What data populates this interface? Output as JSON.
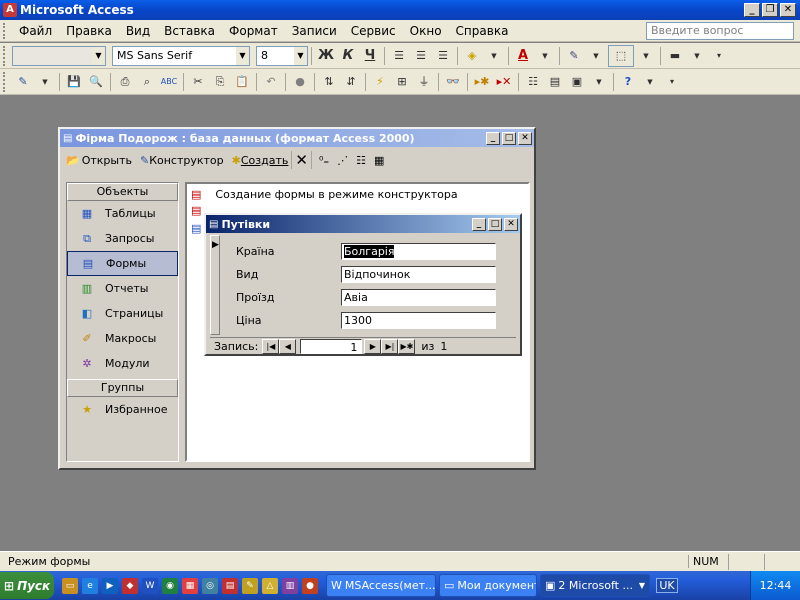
{
  "app": {
    "title": "Microsoft Access"
  },
  "menu": [
    "Файл",
    "Правка",
    "Вид",
    "Вставка",
    "Формат",
    "Записи",
    "Сервис",
    "Окно",
    "Справка"
  ],
  "ask_placeholder": "Введите вопрос",
  "format_toolbar": {
    "object_combo": "",
    "font": "MS Sans Serif",
    "size": "8",
    "bold": "Ж",
    "italic": "К",
    "underline": "Ч"
  },
  "db_window": {
    "title": "Фірма Подорож : база данных (формат Access 2000)",
    "toolbar": {
      "open": "Открыть",
      "design": "Конструктор",
      "create": "Создать"
    },
    "objects_header": "Объекты",
    "objects": [
      "Таблицы",
      "Запросы",
      "Формы",
      "Отчеты",
      "Страницы",
      "Макросы",
      "Модули"
    ],
    "groups_header": "Группы",
    "groups": [
      "Избранное"
    ],
    "list": [
      "Создание формы в режиме конструктора"
    ]
  },
  "form": {
    "title": "Путівки",
    "fields": [
      {
        "label": "Країна",
        "value": "Болгарія"
      },
      {
        "label": "Вид",
        "value": "Відпочинок"
      },
      {
        "label": "Проїзд",
        "value": "Авіа"
      },
      {
        "label": "Ціна",
        "value": "1300"
      }
    ],
    "nav": {
      "label": "Запись:",
      "current": "1",
      "of": "из",
      "total": "1"
    }
  },
  "status": {
    "left": "Режим формы",
    "num": "NUM"
  },
  "taskbar": {
    "start": "Пуск",
    "tasks": [
      "MSAccess(мет...",
      "Мои документы",
      "2 Microsoft ..."
    ],
    "lang": "UK",
    "time": "12:44"
  }
}
